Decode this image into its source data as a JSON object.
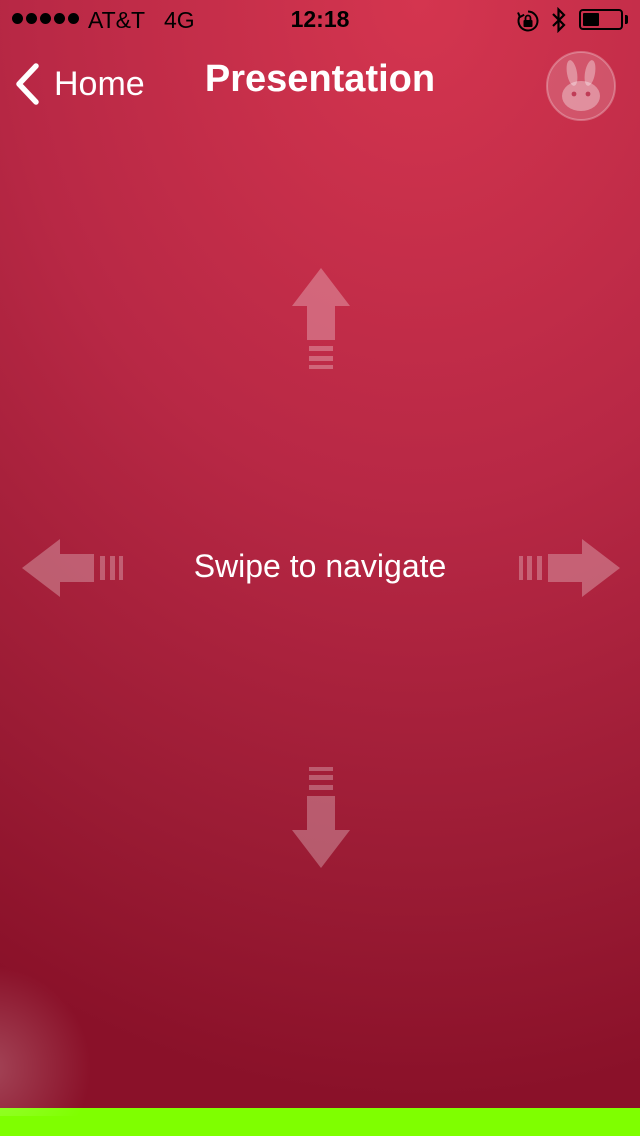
{
  "status_bar": {
    "carrier": "AT&T",
    "network": "4G",
    "time": "12:18",
    "battery_level": 0.45,
    "icons": [
      "signal-dots-icon",
      "orientation-lock-icon",
      "bluetooth-icon",
      "battery-icon"
    ]
  },
  "nav": {
    "back_label": "Home",
    "title": "Presentation",
    "avatar_icon": "bunny-avatar-icon"
  },
  "main": {
    "hint": "Swipe to navigate",
    "arrows": [
      "arrow-up-icon",
      "arrow-left-icon",
      "arrow-right-icon",
      "arrow-down-icon"
    ]
  },
  "colors": {
    "background_top": "#d4354f",
    "background_bottom": "#8a1129",
    "bottom_bar": "#7fff00",
    "text": "#ffffff"
  }
}
